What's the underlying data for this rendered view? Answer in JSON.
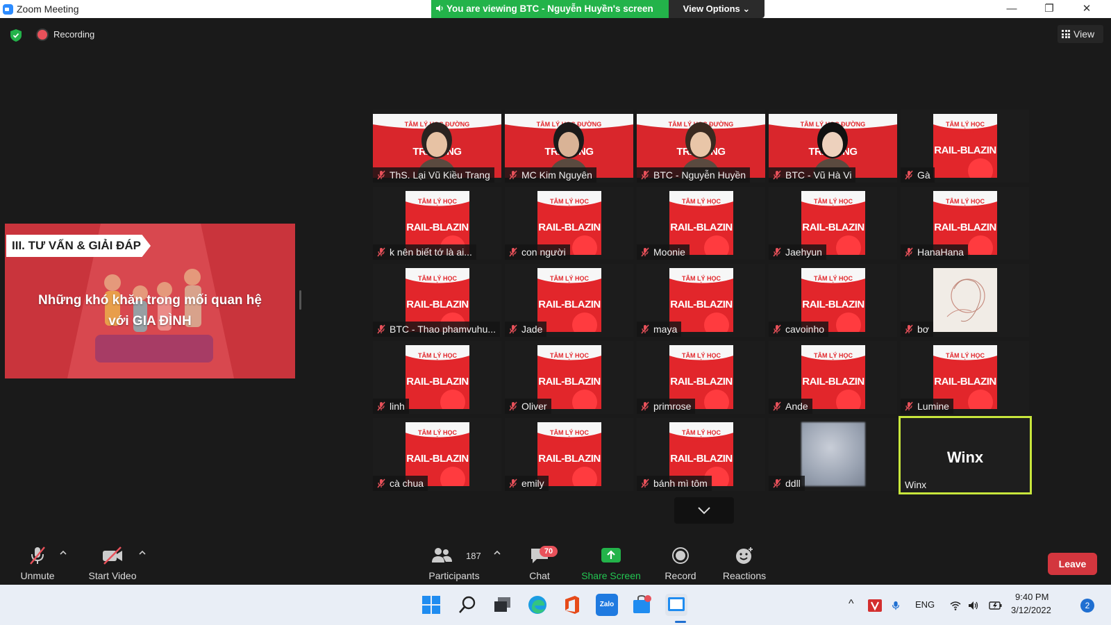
{
  "window": {
    "title": "Zoom Meeting",
    "minimize_glyph": "—",
    "restore_glyph": "❐",
    "close_glyph": "✕"
  },
  "share_banner": {
    "text": "You are viewing BTC - Nguyễn Huyền's screen",
    "view_options_label": "View Options"
  },
  "meeting_bar": {
    "recording_label": "Recording",
    "view_label": "View"
  },
  "shared_slide": {
    "section_badge": "III. TƯ VẤN & GIẢI ĐÁP",
    "line1": "Những khó khăn trong mối quan hệ",
    "line2": "với  GIA ĐÌNH"
  },
  "thumbnail": {
    "header": "TÂM LÝ HỌC ĐƯỜNG",
    "banner": "RAIL-BLAZIN",
    "banner_wide": "TRAIL  ING"
  },
  "participants": [
    {
      "name": "ThS. Lại Vũ Kiều Trang",
      "type": "video"
    },
    {
      "name": "MC Kim Nguyên",
      "type": "video"
    },
    {
      "name": "BTC - Nguyễn Huyền",
      "type": "video"
    },
    {
      "name": "BTC - Vũ Hà Vi",
      "type": "video"
    },
    {
      "name": "Gà",
      "type": "logo"
    },
    {
      "name": "k nên biết tớ là ai...",
      "type": "logo"
    },
    {
      "name": "con người",
      "type": "logo"
    },
    {
      "name": "Moonie",
      "type": "logo"
    },
    {
      "name": "Jaehyun",
      "type": "logo"
    },
    {
      "name": "HanaHana",
      "type": "logo"
    },
    {
      "name": "BTC - Thao phamvuhu...",
      "type": "logo"
    },
    {
      "name": "Jade",
      "type": "logo"
    },
    {
      "name": "maya",
      "type": "logo"
    },
    {
      "name": "cavoinho",
      "type": "logo"
    },
    {
      "name": "bơ",
      "type": "sketch"
    },
    {
      "name": "linh",
      "type": "logo"
    },
    {
      "name": "Oliver",
      "type": "logo"
    },
    {
      "name": "primrose",
      "type": "logo"
    },
    {
      "name": "Ande",
      "type": "logo"
    },
    {
      "name": "Lumine",
      "type": "logo"
    },
    {
      "name": "cà chua",
      "type": "logo"
    },
    {
      "name": "emily",
      "type": "logo"
    },
    {
      "name": "bánh mì tôm",
      "type": "logo"
    },
    {
      "name": "ddll",
      "type": "blur"
    },
    {
      "name": "Winx",
      "type": "active"
    }
  ],
  "toolbar": {
    "unmute_label": "Unmute",
    "start_video_label": "Start Video",
    "participants_label": "Participants",
    "participants_count": "187",
    "chat_label": "Chat",
    "chat_badge": "70",
    "share_screen_label": "Share Screen",
    "record_label": "Record",
    "reactions_label": "Reactions",
    "leave_label": "Leave"
  },
  "taskbar": {
    "language": "ENG",
    "time": "9:40 PM",
    "date": "3/12/2022",
    "notification_count": "2",
    "zalo_label": "Zalo",
    "tray_expand_glyph": "^"
  },
  "colors": {
    "share_green": "#23b34a",
    "active_speaker": "#c8e63c",
    "leave_red": "#d3363e",
    "badge_red": "#e8515a",
    "slide_red": "#c9343c",
    "share_screen_label": "#23c552"
  }
}
